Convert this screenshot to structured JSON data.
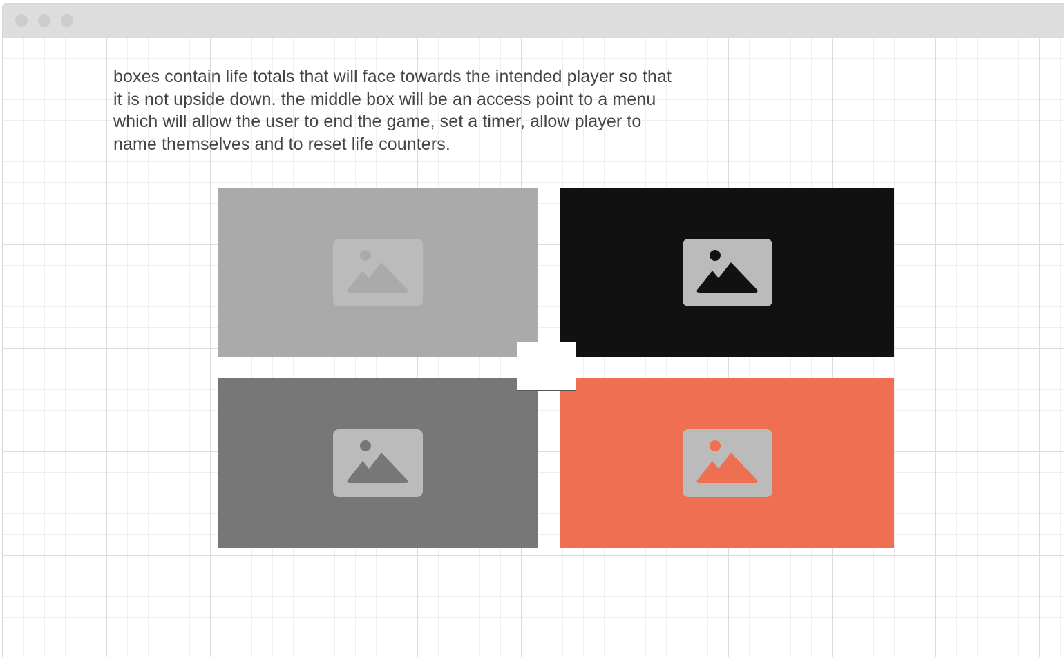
{
  "window": {
    "title_dots": [
      "close",
      "minimize",
      "maximize"
    ]
  },
  "description": {
    "lines": [
      "boxes contain life totals that will face towards the intended player so that",
      "it is not upside down. the middle box will be an access point to a menu",
      "which will allow the user to end the game, set a timer, allow player to",
      "name themselves and to reset life counters."
    ]
  },
  "player_boxes": [
    {
      "id": "top-left",
      "background": "#aaaaaa",
      "icon": "image-placeholder-icon",
      "icon_bg": "#bbbbbb",
      "icon_fg": "#aaaaaa"
    },
    {
      "id": "top-right",
      "background": "#111111",
      "icon": "image-placeholder-icon",
      "icon_bg": "#bbbbbb",
      "icon_fg": "#111111"
    },
    {
      "id": "bottom-left",
      "background": "#777777",
      "icon": "image-placeholder-icon",
      "icon_bg": "#bbbbbb",
      "icon_fg": "#777777"
    },
    {
      "id": "bottom-right",
      "background": "#ef6f53",
      "icon": "image-placeholder-icon",
      "icon_bg": "#bbbbbb",
      "icon_fg": "#ef6f53"
    }
  ],
  "menu_box": {
    "icon": "menu-access-point",
    "background": "#ffffff",
    "border": "#555555"
  },
  "colors": {
    "titlebar": "#dddddd",
    "dots": "#cccccc",
    "text": "#444444",
    "grid_major": "#dcdcdc",
    "grid_minor": "#efefef"
  }
}
